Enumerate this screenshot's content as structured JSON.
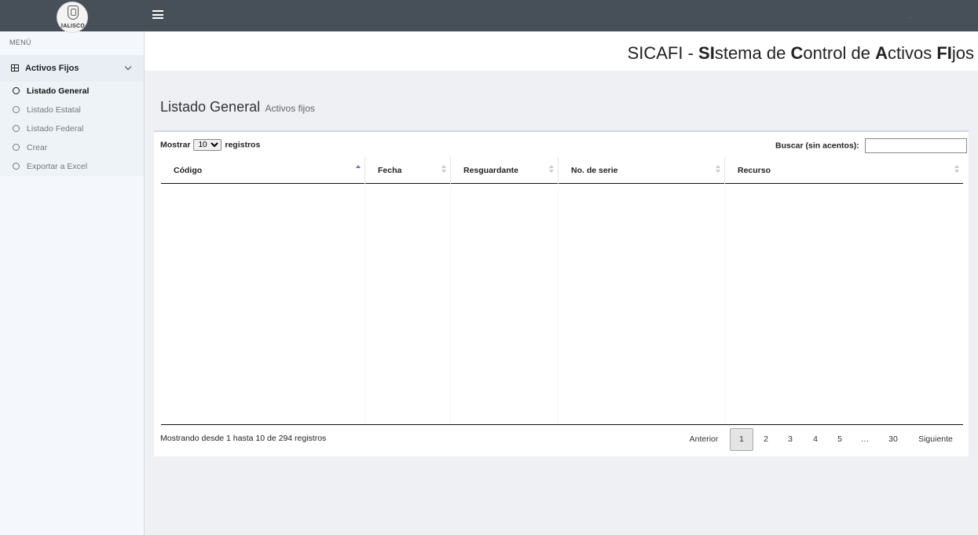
{
  "header": {
    "logo_text": "JALISCO",
    "user_text": "...",
    "banner": {
      "prefix": "SICAFI - ",
      "parts": [
        {
          "b": "SI",
          "t": "stema de "
        },
        {
          "b": "C",
          "t": "ontrol de "
        },
        {
          "b": "A",
          "t": "ctivos "
        },
        {
          "b": "FI",
          "t": "jos"
        }
      ]
    }
  },
  "sidebar": {
    "menu_label": "MENÚ",
    "section": "Activos Fijos",
    "items": [
      {
        "label": "Listado General",
        "active": true
      },
      {
        "label": "Listado Estatal",
        "active": false
      },
      {
        "label": "Listado Federal",
        "active": false
      },
      {
        "label": "Crear",
        "active": false
      },
      {
        "label": "Exportar a Excel",
        "active": false
      }
    ]
  },
  "page": {
    "title": "Listado General",
    "subtitle": "Activos fijos"
  },
  "table": {
    "length_prefix": "Mostrar",
    "length_value": "10",
    "length_suffix": "registros",
    "search_label": "Buscar (sin acentos):",
    "search_value": "",
    "columns": [
      "Código",
      "Fecha",
      "Resguardante",
      "No. de serie",
      "Recurso"
    ],
    "info": "Mostrando desde 1 hasta 10 de 294 registros",
    "pagination": [
      "Anterior",
      "1",
      "2",
      "3",
      "4",
      "5",
      "…",
      "30",
      "Siguiente"
    ],
    "current_page": "1"
  }
}
